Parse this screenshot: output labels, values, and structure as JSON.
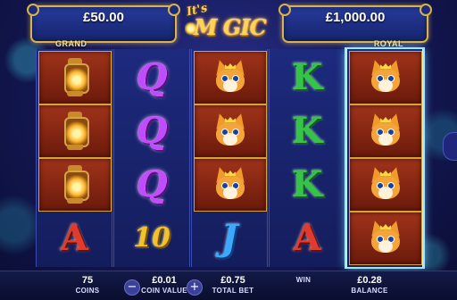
{
  "jackpots": {
    "grand": {
      "amount": "£50.00",
      "label": "GRAND"
    },
    "royal": {
      "amount": "£1,000.00",
      "label": "ROYAL"
    }
  },
  "logo": {
    "line1": "It's",
    "line2": "M GIC"
  },
  "reels": [
    {
      "highlighted": false,
      "symbols": [
        "lantern",
        "lantern",
        "lantern",
        "A"
      ]
    },
    {
      "highlighted": false,
      "symbols": [
        "Q",
        "Q",
        "Q",
        "10"
      ]
    },
    {
      "highlighted": false,
      "symbols": [
        "fox",
        "fox",
        "fox",
        "J"
      ]
    },
    {
      "highlighted": false,
      "symbols": [
        "K",
        "K",
        "K",
        "A"
      ]
    },
    {
      "highlighted": true,
      "symbols": [
        "fox",
        "fox",
        "fox",
        "fox"
      ]
    }
  ],
  "bottom_bar": {
    "coins": {
      "value": "75",
      "label": "COINS"
    },
    "coin_value": {
      "value": "£0.01",
      "label": "COIN VALUE",
      "minus": "−",
      "plus": "+"
    },
    "total_bet": {
      "value": "£0.75",
      "label": "TOTAL BET"
    },
    "win": {
      "value": "",
      "label": "WIN"
    },
    "balance": {
      "value": "£0.28",
      "label": "BALANCE"
    }
  },
  "colors": {
    "accent_gold": "#d8b24a",
    "reel_bg": "#1d2a7e",
    "highlight": "#9fe6ff"
  }
}
